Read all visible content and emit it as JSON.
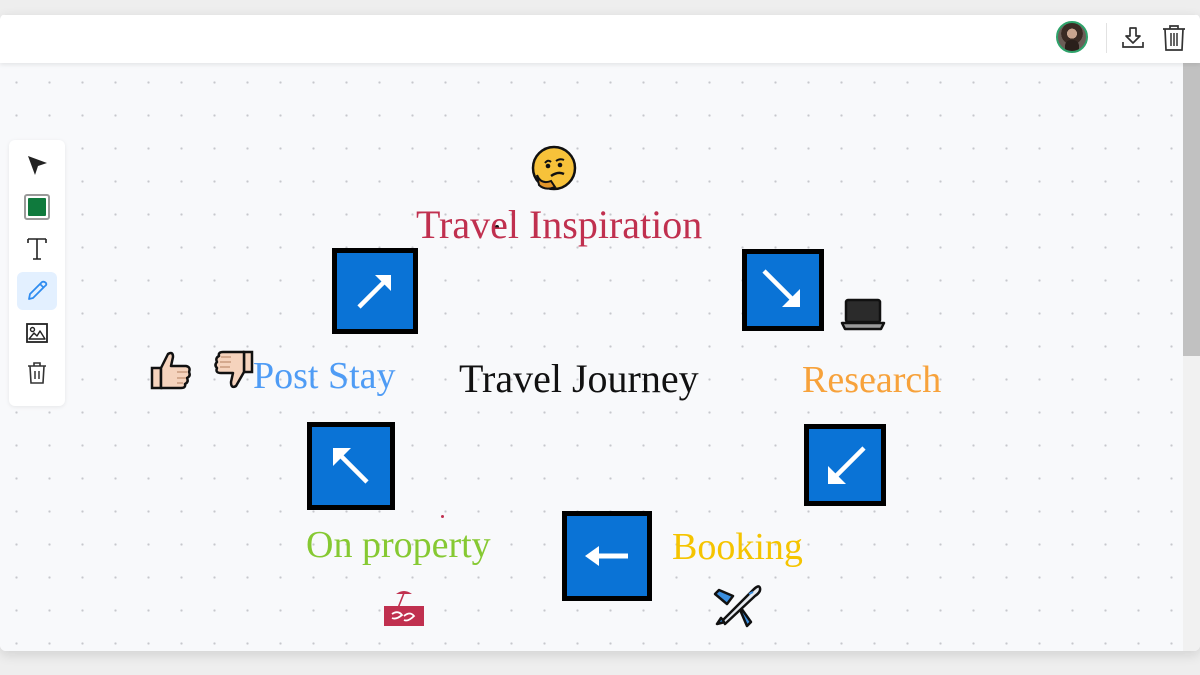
{
  "topbar": {
    "avatar_alt": "User avatar",
    "download_label": "Download",
    "delete_label": "Delete board"
  },
  "toolbar": {
    "tools": [
      {
        "id": "select",
        "label": "Select"
      },
      {
        "id": "color",
        "label": "Fill color",
        "color": "#0f7a3d"
      },
      {
        "id": "text",
        "label": "Text"
      },
      {
        "id": "pen",
        "label": "Pen",
        "active": true
      },
      {
        "id": "image",
        "label": "Image"
      },
      {
        "id": "delete",
        "label": "Delete"
      }
    ]
  },
  "canvas": {
    "labels": {
      "center": {
        "text": "Travel Journey",
        "color": "#111111"
      },
      "inspiration": {
        "text": "Travel Inspiration",
        "color": "#c0304f"
      },
      "research": {
        "text": "Research",
        "color": "#f7a23b"
      },
      "booking": {
        "text": "Booking",
        "color": "#f5c400"
      },
      "on_property": {
        "text": "On property",
        "color": "#86c932"
      },
      "post_stay": {
        "text": "Post Stay",
        "color": "#4f9cf5"
      }
    },
    "arrows": [
      {
        "id": "to-inspiration",
        "direction": "north-east",
        "glyph": "↗"
      },
      {
        "id": "to-research",
        "direction": "south-east",
        "glyph": "↘"
      },
      {
        "id": "to-booking",
        "direction": "south-west",
        "glyph": "↙"
      },
      {
        "id": "to-on-property",
        "direction": "west",
        "glyph": "←"
      },
      {
        "id": "to-post-stay",
        "direction": "north-west",
        "glyph": "↖"
      }
    ],
    "stickers": [
      {
        "id": "thinking-face",
        "glyph": "🤔"
      },
      {
        "id": "laptop",
        "glyph": "💻"
      },
      {
        "id": "airplane",
        "glyph": "✈"
      },
      {
        "id": "beach-hotel",
        "glyph": "🏖"
      },
      {
        "id": "thumbs-up",
        "glyph": "👍"
      },
      {
        "id": "thumbs-down",
        "glyph": "👎"
      }
    ],
    "brand_colors": {
      "arrow_fill": "#0a73d6",
      "arrow_border": "#000000",
      "accent": "#2ea36b"
    }
  }
}
